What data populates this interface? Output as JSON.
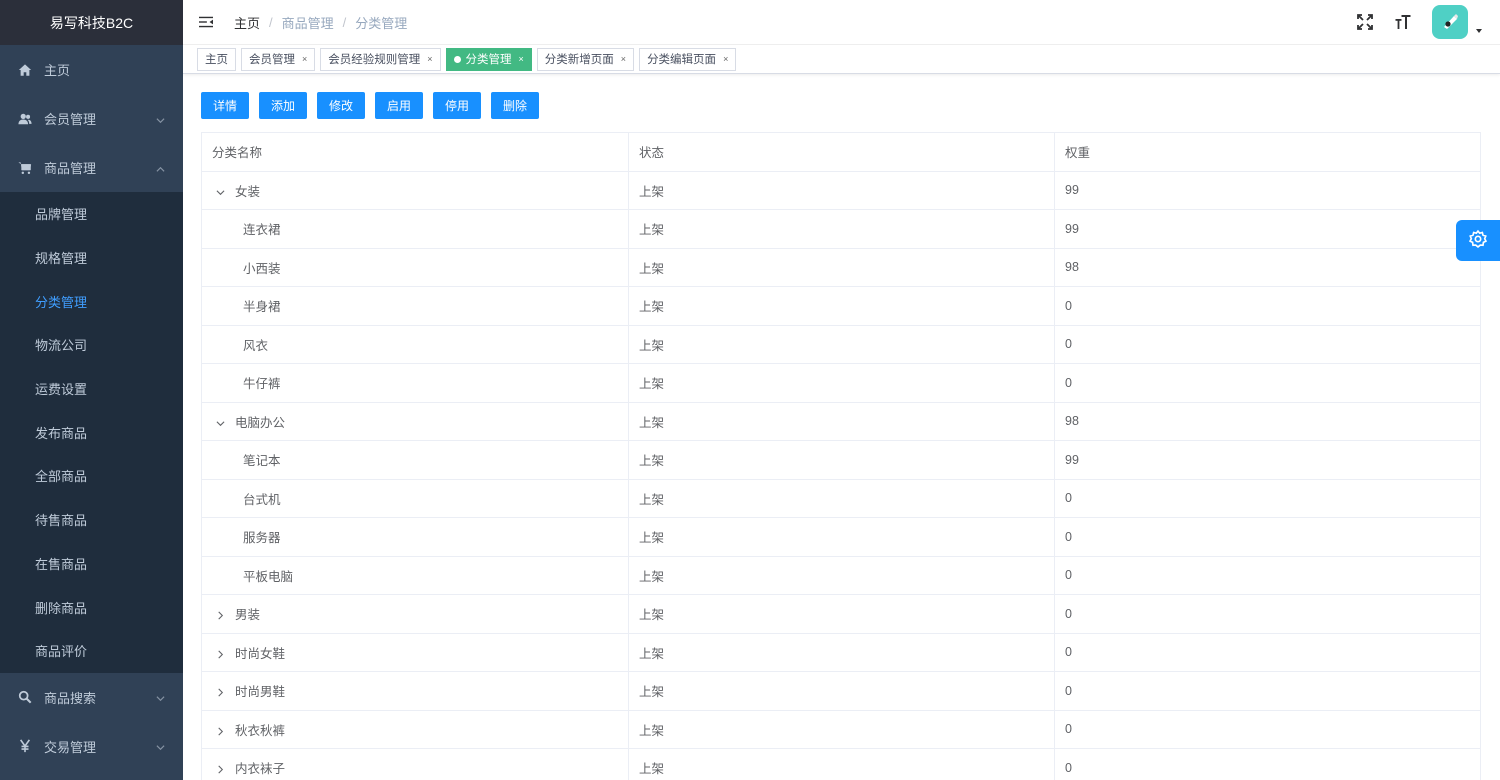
{
  "app": {
    "title": "易写科技B2C"
  },
  "sidebar": {
    "items": [
      {
        "label": "主页",
        "icon": "home-icon"
      },
      {
        "label": "会员管理",
        "icon": "users-icon"
      },
      {
        "label": "商品管理",
        "icon": "cart-icon"
      }
    ],
    "submenu": [
      {
        "label": "品牌管理"
      },
      {
        "label": "规格管理"
      },
      {
        "label": "分类管理",
        "active": true
      },
      {
        "label": "物流公司"
      },
      {
        "label": "运费设置"
      },
      {
        "label": "发布商品"
      },
      {
        "label": "全部商品"
      },
      {
        "label": "待售商品"
      },
      {
        "label": "在售商品"
      },
      {
        "label": "删除商品"
      },
      {
        "label": "商品评价"
      }
    ],
    "bottom_items": [
      {
        "label": "商品搜索",
        "icon": "search-icon"
      },
      {
        "label": "交易管理",
        "icon": "yen-icon"
      }
    ]
  },
  "header": {
    "breadcrumb": [
      "主页",
      "商品管理",
      "分类管理"
    ],
    "separator": "/"
  },
  "tags": [
    {
      "label": "主页",
      "closable": false
    },
    {
      "label": "会员管理",
      "closable": true
    },
    {
      "label": "会员经验规则管理",
      "closable": true
    },
    {
      "label": "分类管理",
      "closable": true,
      "active": true
    },
    {
      "label": "分类新增页面",
      "closable": true
    },
    {
      "label": "分类编辑页面",
      "closable": true
    }
  ],
  "tag_close": "×",
  "toolbar": {
    "buttons": [
      "详情",
      "添加",
      "修改",
      "启用",
      "停用",
      "删除"
    ]
  },
  "table": {
    "headers": [
      "分类名称",
      "状态",
      "权重"
    ],
    "rows": [
      {
        "name": "女装",
        "status": "上架",
        "weight": "99",
        "level": 0,
        "expanded": true
      },
      {
        "name": "连衣裙",
        "status": "上架",
        "weight": "99",
        "level": 1
      },
      {
        "name": "小西装",
        "status": "上架",
        "weight": "98",
        "level": 1
      },
      {
        "name": "半身裙",
        "status": "上架",
        "weight": "0",
        "level": 1
      },
      {
        "name": "风衣",
        "status": "上架",
        "weight": "0",
        "level": 1
      },
      {
        "name": "牛仔裤",
        "status": "上架",
        "weight": "0",
        "level": 1
      },
      {
        "name": "电脑办公",
        "status": "上架",
        "weight": "98",
        "level": 0,
        "expanded": true
      },
      {
        "name": "笔记本",
        "status": "上架",
        "weight": "99",
        "level": 1
      },
      {
        "name": "台式机",
        "status": "上架",
        "weight": "0",
        "level": 1
      },
      {
        "name": "服务器",
        "status": "上架",
        "weight": "0",
        "level": 1
      },
      {
        "name": "平板电脑",
        "status": "上架",
        "weight": "0",
        "level": 1
      },
      {
        "name": "男装",
        "status": "上架",
        "weight": "0",
        "level": 0,
        "expanded": false
      },
      {
        "name": "时尚女鞋",
        "status": "上架",
        "weight": "0",
        "level": 0,
        "expanded": false
      },
      {
        "name": "时尚男鞋",
        "status": "上架",
        "weight": "0",
        "level": 0,
        "expanded": false
      },
      {
        "name": "秋衣秋裤",
        "status": "上架",
        "weight": "0",
        "level": 0,
        "expanded": false
      },
      {
        "name": "内衣袜子",
        "status": "上架",
        "weight": "0",
        "level": 0,
        "expanded": false
      }
    ]
  },
  "colors": {
    "sidebar_bg": "#304156",
    "submenu_bg": "#1f2d3d",
    "logo_bg": "#2b2f3a",
    "accent": "#409eff",
    "button": "#1890ff",
    "active_tag": "#42b983"
  }
}
